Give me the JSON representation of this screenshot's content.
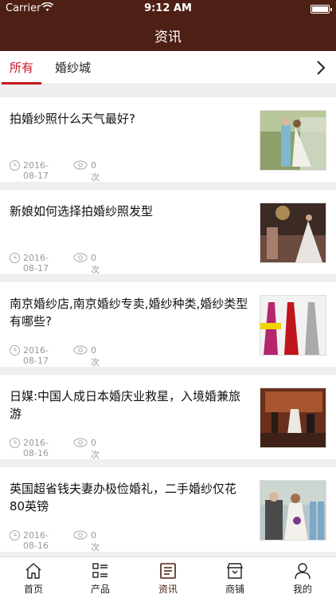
{
  "status_bar": {
    "carrier": "Carrier",
    "time": "9:12 AM"
  },
  "nav": {
    "title": "资讯"
  },
  "tabs": [
    {
      "label": "所有",
      "active": true
    },
    {
      "label": "婚纱城",
      "active": false
    }
  ],
  "articles": [
    {
      "title": "拍婚纱照什么天气最好?",
      "date": "2016-08-17",
      "views": "0次",
      "thumb": "wedding-couple-outdoor"
    },
    {
      "title": "新娘如何选择拍婚纱照发型",
      "date": "2016-08-17",
      "views": "0次",
      "thumb": "bridal-shop-interior"
    },
    {
      "title": "南京婚纱店,南京婚纱专卖,婚纱种类,婚纱类型有哪些?",
      "date": "2016-08-17",
      "views": "0次",
      "thumb": "evening-gowns"
    },
    {
      "title": "日媒:中国人成日本婚庆业救星，入境婚兼旅游",
      "date": "2016-08-16",
      "views": "0次",
      "thumb": "church-wedding"
    },
    {
      "title": "英国超省钱夫妻办极俭婚礼，二手婚纱仅花80英镑",
      "date": "2016-08-16",
      "views": "0次",
      "thumb": "wedding-party"
    }
  ],
  "tabbar": [
    {
      "label": "首页",
      "icon": "home-icon"
    },
    {
      "label": "产品",
      "icon": "list-icon"
    },
    {
      "label": "资讯",
      "icon": "news-icon",
      "active": true
    },
    {
      "label": "商铺",
      "icon": "shop-icon"
    },
    {
      "label": "我的",
      "icon": "user-icon"
    }
  ],
  "colors": {
    "nav_bg": "#4e1f14",
    "accent": "#c8161d",
    "muted": "#999999"
  }
}
